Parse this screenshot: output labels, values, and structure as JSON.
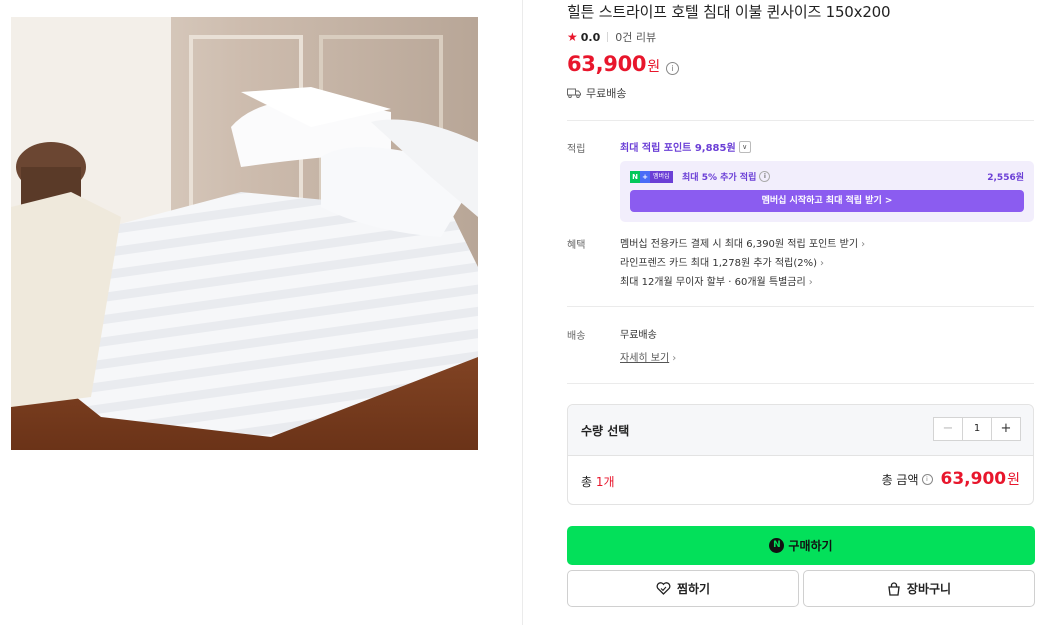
{
  "product": {
    "title": "힐튼 스트라이프 호텔 침대 이불 퀸사이즈 150x200",
    "rating": "0.0",
    "review_count": "0건 리뷰",
    "price": "63,900",
    "currency": "원",
    "shipping_badge": "무료배송"
  },
  "points": {
    "label": "적립",
    "max_points": "최대 적립 포인트 9,885원",
    "membership_badge_n": "N",
    "membership_badge_plus": "+",
    "membership_badge_text": "멤버십",
    "membership_extra": "최대 5% 추가 적립",
    "membership_extra_amount": "2,556원",
    "membership_button": "멤버십 시작하고 최대 적립 받기 >"
  },
  "benefits": {
    "label": "혜택",
    "items": [
      "멤버십 전용카드 결제 시 최대 6,390원 적립 포인트 받기",
      "라인프렌즈 카드 최대 1,278원 추가 적립(2%)",
      "최대 12개월 무이자 할부 · 60개월 특별금리"
    ]
  },
  "delivery": {
    "label": "배송",
    "value": "무료배송",
    "detail_link": "자세히 보기"
  },
  "quantity": {
    "title": "수량 선택",
    "value": "1",
    "minus": "−",
    "plus": "+",
    "total_prefix": "총 ",
    "total_count": "1개",
    "total_amount_label": "총 금액",
    "total_price": "63,900",
    "total_currency": "원"
  },
  "actions": {
    "buy": "구매하기",
    "buy_icon_letter": "N",
    "wish": "찜하기",
    "cart": "장바구니"
  },
  "colors": {
    "price_red": "#e8162c",
    "naver_green": "#03e05a",
    "membership_purple": "#6b3fd6"
  }
}
